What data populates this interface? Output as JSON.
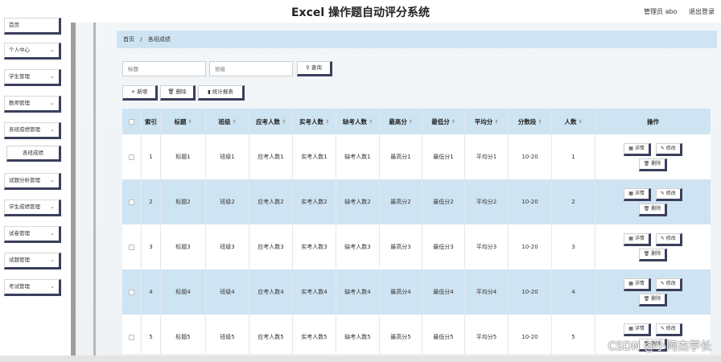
{
  "app": {
    "title": "Excel 操作题自动评分系统"
  },
  "user": {
    "name": "管理员 abo",
    "logout": "退出登录"
  },
  "sidebar": {
    "items": [
      {
        "label": "首页",
        "chevron": ""
      },
      {
        "label": "个人中心",
        "chevron": "⌄"
      },
      {
        "label": "学生管理",
        "chevron": "⌄"
      },
      {
        "label": "教师管理",
        "chevron": "⌄"
      },
      {
        "label": "各班成绩管理",
        "chevron": "⌄"
      },
      {
        "label": "各班成绩",
        "chevron": ""
      },
      {
        "label": "试题分析管理",
        "chevron": "⌄"
      },
      {
        "label": "学生成绩管理",
        "chevron": "⌄"
      },
      {
        "label": "试卷管理",
        "chevron": "⌄"
      },
      {
        "label": "试题管理",
        "chevron": "⌄"
      },
      {
        "label": "考试管理",
        "chevron": "⌄"
      }
    ]
  },
  "breadcrumb": {
    "home": "首页",
    "sep": "/",
    "current": "各班成绩"
  },
  "search": {
    "title_placeholder": "标题",
    "class_placeholder": "班级",
    "button": "查询"
  },
  "actions": {
    "add": "新增",
    "delete": "删除",
    "report": "统计报表"
  },
  "icons": {
    "add": "plus-icon",
    "delete": "trash-icon",
    "report": "bar-chart-icon",
    "search": "search-icon",
    "detail": "detail-icon",
    "edit": "edit-icon"
  },
  "table": {
    "headers": {
      "index": "索引",
      "title": "标题",
      "class": "班级",
      "exam_count": "应考人数",
      "actual_count": "实考人数",
      "absent_count": "缺考人数",
      "max": "最高分",
      "min": "最低分",
      "avg": "平均分",
      "range": "分数段",
      "count": "人数",
      "ops": "操作"
    },
    "sort_mark": "⇕",
    "op_labels": {
      "detail": "详情",
      "edit": "修改",
      "delete": "删除"
    },
    "rows": [
      {
        "index": "1",
        "title": "标题1",
        "class": "班级1",
        "exam_count": "应考人数1",
        "actual_count": "实考人数1",
        "absent_count": "缺考人数1",
        "max": "最高分1",
        "min": "最低分1",
        "avg": "平均分1",
        "range": "10-20",
        "count": "1"
      },
      {
        "index": "2",
        "title": "标题2",
        "class": "班级2",
        "exam_count": "应考人数2",
        "actual_count": "实考人数2",
        "absent_count": "缺考人数2",
        "max": "最高分2",
        "min": "最低分2",
        "avg": "平均分2",
        "range": "10-20",
        "count": "2"
      },
      {
        "index": "3",
        "title": "标题3",
        "class": "班级3",
        "exam_count": "应考人数3",
        "actual_count": "实考人数3",
        "absent_count": "缺考人数3",
        "max": "最高分3",
        "min": "最低分3",
        "avg": "平均分3",
        "range": "10-20",
        "count": "3"
      },
      {
        "index": "4",
        "title": "标题4",
        "class": "班级4",
        "exam_count": "应考人数4",
        "actual_count": "实考人数4",
        "absent_count": "缺考人数4",
        "max": "最高分4",
        "min": "最低分4",
        "avg": "平均分4",
        "range": "10-20",
        "count": "4"
      },
      {
        "index": "5",
        "title": "标题5",
        "class": "班级5",
        "exam_count": "应考人数5",
        "actual_count": "实考人数5",
        "absent_count": "缺考人数5",
        "max": "最高分5",
        "min": "最低分5",
        "avg": "平均分5",
        "range": "10-20",
        "count": "5"
      }
    ]
  },
  "watermark": "CSDN @小阿杰学长"
}
